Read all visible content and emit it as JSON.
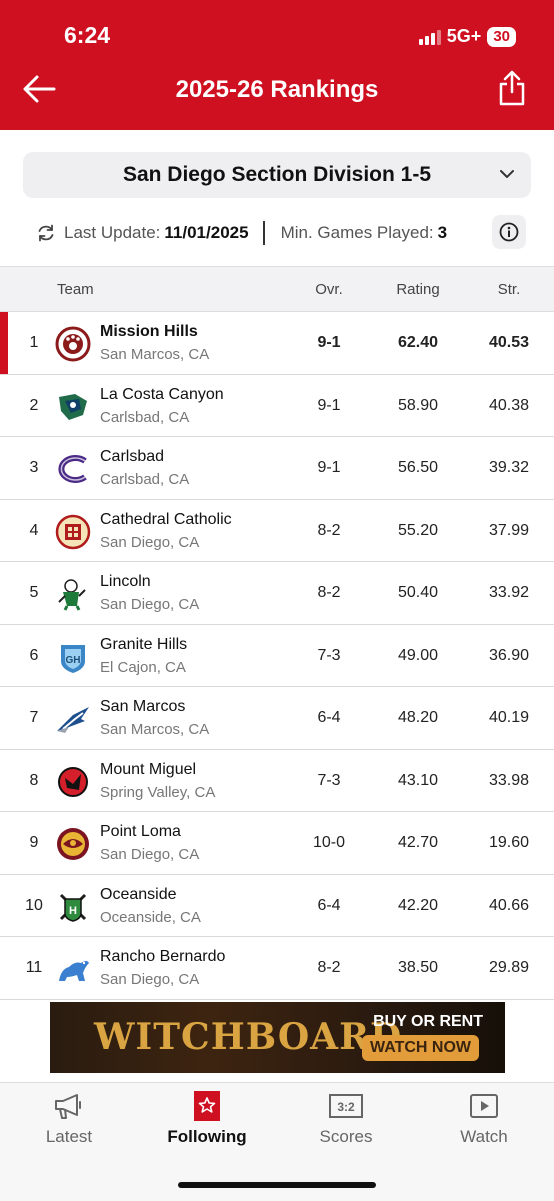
{
  "status_bar": {
    "time": "6:24",
    "network": "5G+",
    "battery": "30"
  },
  "header": {
    "title": "2025-26 Rankings"
  },
  "division": {
    "selected": "San Diego Section Division 1-5"
  },
  "update_info": {
    "last_update_label": "Last Update:",
    "last_update_value": "11/01/2025",
    "min_games_label": "Min. Games Played:",
    "min_games_value": "3"
  },
  "table": {
    "headers": {
      "team": "Team",
      "ovr": "Ovr.",
      "rating": "Rating",
      "str": "Str."
    },
    "rows": [
      {
        "rank": "1",
        "name": "Mission Hills",
        "location": "San Marcos, CA",
        "ovr": "9-1",
        "rating": "62.40",
        "str": "40.53"
      },
      {
        "rank": "2",
        "name": "La Costa Canyon",
        "location": "Carlsbad, CA",
        "ovr": "9-1",
        "rating": "58.90",
        "str": "40.38"
      },
      {
        "rank": "3",
        "name": "Carlsbad",
        "location": "Carlsbad, CA",
        "ovr": "9-1",
        "rating": "56.50",
        "str": "39.32"
      },
      {
        "rank": "4",
        "name": "Cathedral Catholic",
        "location": "San Diego, CA",
        "ovr": "8-2",
        "rating": "55.20",
        "str": "37.99"
      },
      {
        "rank": "5",
        "name": "Lincoln",
        "location": "San Diego, CA",
        "ovr": "8-2",
        "rating": "50.40",
        "str": "33.92"
      },
      {
        "rank": "6",
        "name": "Granite Hills",
        "location": "El Cajon, CA",
        "ovr": "7-3",
        "rating": "49.00",
        "str": "36.90"
      },
      {
        "rank": "7",
        "name": "San Marcos",
        "location": "San Marcos, CA",
        "ovr": "6-4",
        "rating": "48.20",
        "str": "40.19"
      },
      {
        "rank": "8",
        "name": "Mount Miguel",
        "location": "Spring Valley, CA",
        "ovr": "7-3",
        "rating": "43.10",
        "str": "33.98"
      },
      {
        "rank": "9",
        "name": "Point Loma",
        "location": "San Diego, CA",
        "ovr": "10-0",
        "rating": "42.70",
        "str": "19.60"
      },
      {
        "rank": "10",
        "name": "Oceanside",
        "location": "Oceanside, CA",
        "ovr": "6-4",
        "rating": "42.20",
        "str": "40.66"
      },
      {
        "rank": "11",
        "name": "Rancho Bernardo",
        "location": "San Diego, CA",
        "ovr": "8-2",
        "rating": "38.50",
        "str": "29.89"
      }
    ]
  },
  "ad": {
    "title": "WITCHBOARD",
    "cta_line1": "BUY OR RENT",
    "cta_line2": "WATCH NOW"
  },
  "tabs": [
    {
      "label": "Latest",
      "icon": "megaphone-icon"
    },
    {
      "label": "Following",
      "icon": "star-bookmark-icon"
    },
    {
      "label": "Scores",
      "icon": "scoreboard-icon"
    },
    {
      "label": "Watch",
      "icon": "play-icon"
    }
  ],
  "colors": {
    "brand_red": "#cf1021"
  }
}
